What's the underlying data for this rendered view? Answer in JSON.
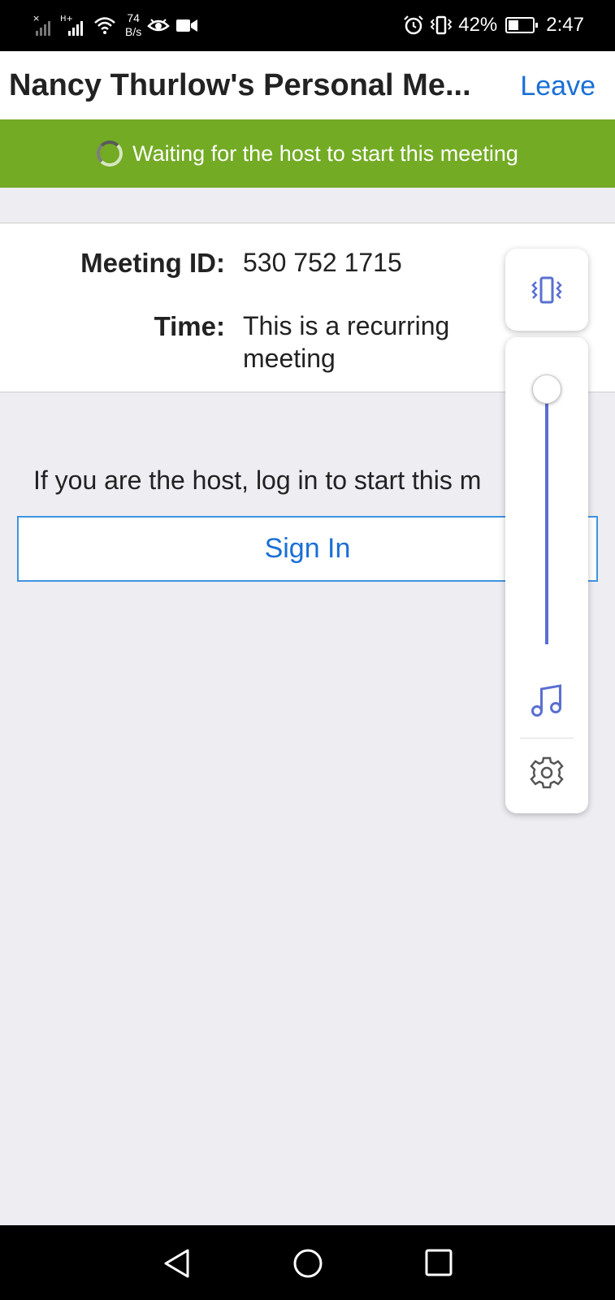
{
  "status_bar": {
    "net_speed_value": "74",
    "net_speed_unit": "B/s",
    "battery": "42%",
    "battery_level": 0.42,
    "time": "2:47"
  },
  "header": {
    "title": "Nancy Thurlow's Personal Me...",
    "leave_label": "Leave"
  },
  "banner": {
    "text": "Waiting for the host to start this meeting",
    "color": "#73ab25"
  },
  "info": {
    "meeting_id_label": "Meeting ID:",
    "meeting_id_value": "530 752 1715",
    "time_label": "Time:",
    "time_value": "This is a recurring meeting"
  },
  "host": {
    "prompt": "If you are the host, log in to start this m",
    "sign_in_label": "Sign In"
  },
  "volume_panel": {
    "mode_icon": "vibrate-icon",
    "level": 1.0,
    "media_icon": "music-note-icon",
    "settings_icon": "gear-icon",
    "accent_color": "#5a6fd1"
  },
  "nav_bar": {
    "back_icon": "back-triangle-icon",
    "home_icon": "home-circle-icon",
    "recents_icon": "recents-square-icon"
  }
}
